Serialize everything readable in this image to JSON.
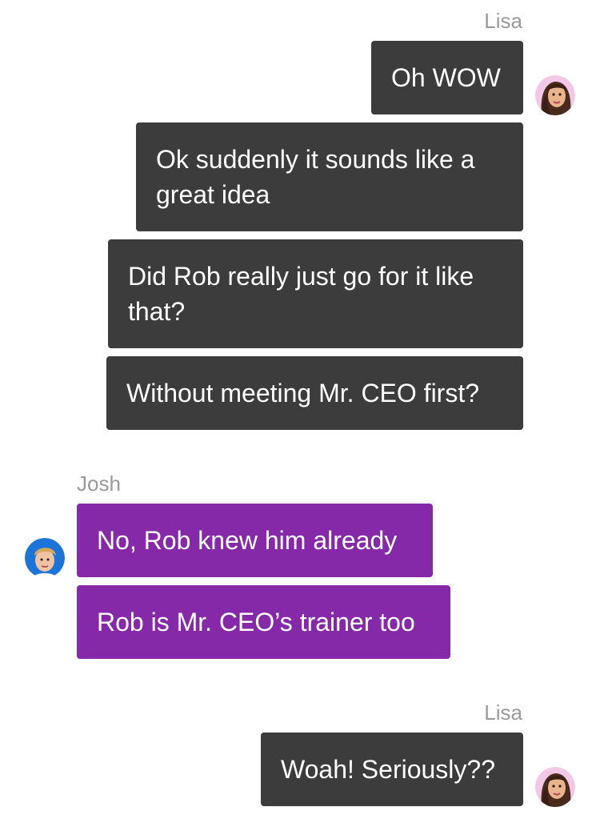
{
  "conversation": [
    {
      "sender": "Lisa",
      "side": "right",
      "avatar_icon": "lisa-avatar-icon",
      "messages": [
        "Oh WOW",
        "Ok suddenly it sounds like a great idea",
        "Did Rob really just go for it like that?",
        "Without meeting Mr. CEO first?"
      ]
    },
    {
      "sender": "Josh",
      "side": "left",
      "avatar_icon": "josh-avatar-icon",
      "messages": [
        "No, Rob knew him already",
        "Rob is Mr. CEO’s trainer too"
      ]
    },
    {
      "sender": "Lisa",
      "side": "right",
      "avatar_icon": "lisa-avatar-icon",
      "messages": [
        "Woah! Seriously??"
      ]
    }
  ],
  "colors": {
    "outgoing_bubble": "#3c3c3c",
    "incoming_bubble": "#8529a8",
    "sender_name": "#9a9a9a",
    "bubble_text": "#ffffff"
  }
}
